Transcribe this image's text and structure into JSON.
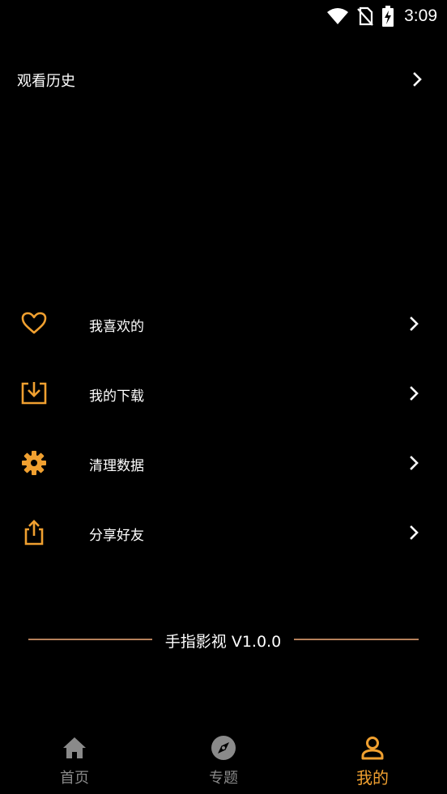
{
  "status_bar": {
    "time": "3:09",
    "icons": [
      "wifi-icon",
      "no-sim-icon",
      "battery-charging-icon"
    ]
  },
  "history": {
    "label": "观看历史"
  },
  "menu": [
    {
      "label": "我喜欢的",
      "icon": "heart-icon"
    },
    {
      "label": "我的下载",
      "icon": "download-icon"
    },
    {
      "label": "清理数据",
      "icon": "gear-icon"
    },
    {
      "label": "分享好友",
      "icon": "share-icon"
    }
  ],
  "version": {
    "text": "手指影视 V1.0.0"
  },
  "bottom_nav": {
    "tabs": [
      {
        "label": "首页",
        "icon": "home-icon",
        "active": false
      },
      {
        "label": "专题",
        "icon": "compass-icon",
        "active": false
      },
      {
        "label": "我的",
        "icon": "person-icon",
        "active": true
      }
    ]
  },
  "colors": {
    "background": "#000000",
    "accent": "#f0a030",
    "divider": "#b5805b",
    "inactive": "#8a8a8a"
  }
}
